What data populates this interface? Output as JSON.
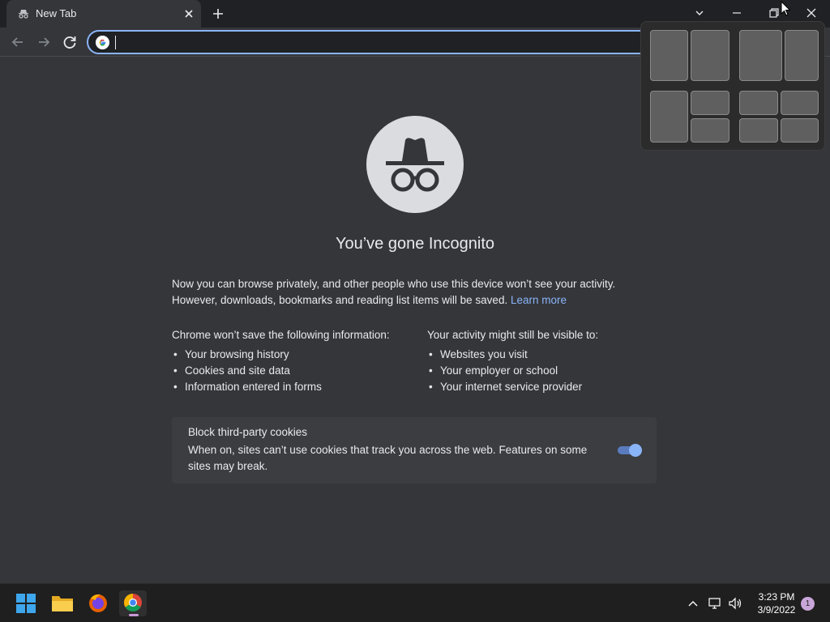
{
  "tab": {
    "title": "New Tab",
    "icon": "incognito-icon"
  },
  "window_controls": [
    "tab-search-icon",
    "minimize-icon",
    "restore-icon",
    "close-icon"
  ],
  "omnibox": {
    "value": "",
    "icon": "google-icon"
  },
  "snap_layouts": {
    "layouts": [
      "half-half",
      "two-thirds-one-third",
      "left-half-right-quarters",
      "quarters"
    ]
  },
  "incognito": {
    "heading": "You’ve gone Incognito",
    "intro_line1": "Now you can browse privately, and other people who use this device won’t see your activity.",
    "intro_line2": "However, downloads, bookmarks and reading list items will be saved.",
    "learn_more": "Learn more",
    "not_saved": {
      "title": "Chrome won’t save the following information:",
      "items": [
        "Your browsing history",
        "Cookies and site data",
        "Information entered in forms"
      ]
    },
    "visible_to": {
      "title": "Your activity might still be visible to:",
      "items": [
        "Websites you visit",
        "Your employer or school",
        "Your internet service provider"
      ]
    },
    "cookies": {
      "title": "Block third-party cookies",
      "description": "When on, sites can’t use cookies that track you across the web. Features on some sites may break.",
      "enabled": true
    }
  },
  "taskbar": {
    "apps": [
      "windows-start-icon",
      "file-explorer-icon",
      "firefox-icon",
      "chrome-icon"
    ],
    "tray": [
      "chevron-up-icon",
      "network-icon",
      "volume-icon"
    ],
    "time": "3:23 PM",
    "date": "3/9/2022",
    "notifications": "1"
  },
  "colors": {
    "accent": "#8ab4f8",
    "background": "#35363a",
    "titlebar": "#202124",
    "taskbar": "#1f1f1f"
  }
}
